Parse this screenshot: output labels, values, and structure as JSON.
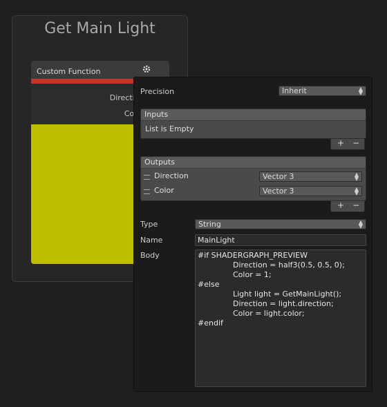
{
  "group": {
    "title": "Get Main Light"
  },
  "node": {
    "title": "Custom Function",
    "outputs": [
      "Direction(3)",
      "Color(3)"
    ],
    "preview_color": "#bfbf00",
    "accent_color": "#c63628"
  },
  "panel": {
    "precision": {
      "label": "Precision",
      "value": "Inherit"
    },
    "inputs": {
      "header": "Inputs",
      "empty_text": "List is Empty",
      "add": "+",
      "remove": "−"
    },
    "outputs": {
      "header": "Outputs",
      "rows": [
        {
          "name": "Direction",
          "type": "Vector 3"
        },
        {
          "name": "Color",
          "type": "Vector 3"
        }
      ],
      "add": "+",
      "remove": "−"
    },
    "type": {
      "label": "Type",
      "value": "String"
    },
    "name": {
      "label": "Name",
      "value": "MainLight"
    },
    "body": {
      "label": "Body",
      "lines": [
        "#if SHADERGRAPH_PREVIEW",
        "Direction = half3(0.5, 0.5, 0);",
        "Color = 1;",
        "#else",
        "Light light = GetMainLight();",
        "Direction = light.direction;",
        "Color = light.color;",
        "#endif"
      ]
    }
  }
}
